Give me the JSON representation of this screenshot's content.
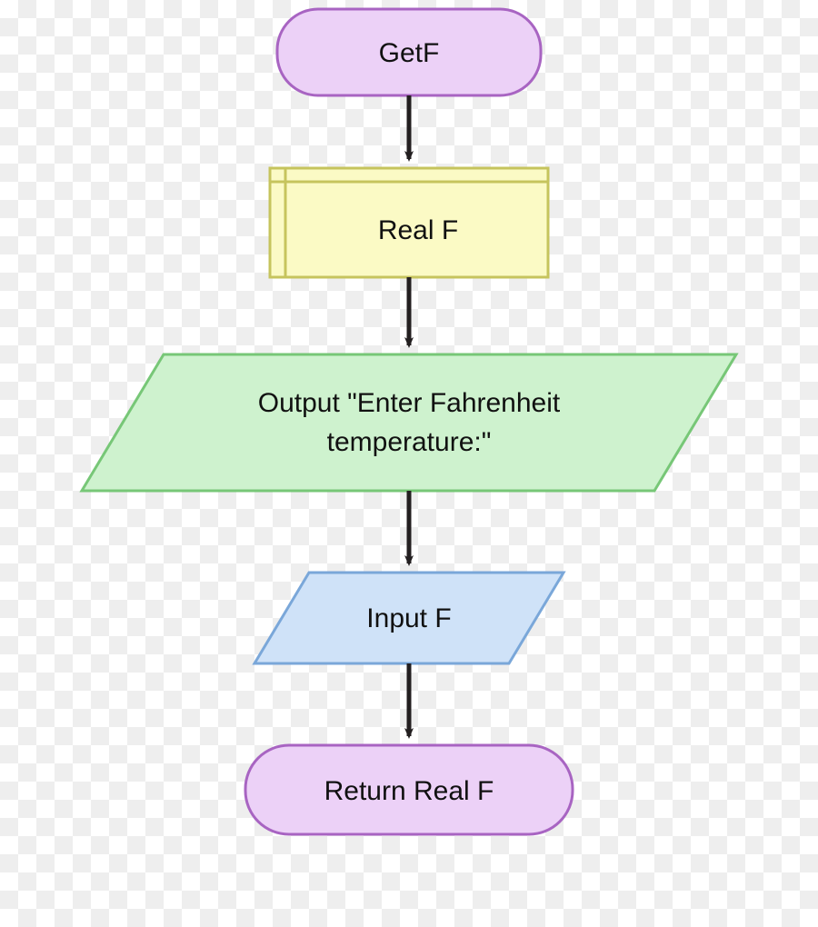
{
  "diagram": {
    "type": "flowchart",
    "colors": {
      "terminator_fill": "#ecd1f7",
      "terminator_stroke": "#a864c2",
      "declare_fill": "#fbfac5",
      "declare_stroke": "#c6c45d",
      "output_fill": "#cef2ce",
      "output_stroke": "#77c777",
      "input_fill": "#cfe2f8",
      "input_stroke": "#7aa7d9",
      "arrow": "#231f20"
    },
    "nodes": {
      "start": {
        "label": "GetF"
      },
      "declare": {
        "label": "Real F"
      },
      "output": {
        "line1": "Output \"Enter Fahrenheit",
        "line2": "temperature:\""
      },
      "input": {
        "label": "Input F"
      },
      "return": {
        "label": "Return Real F"
      }
    }
  }
}
